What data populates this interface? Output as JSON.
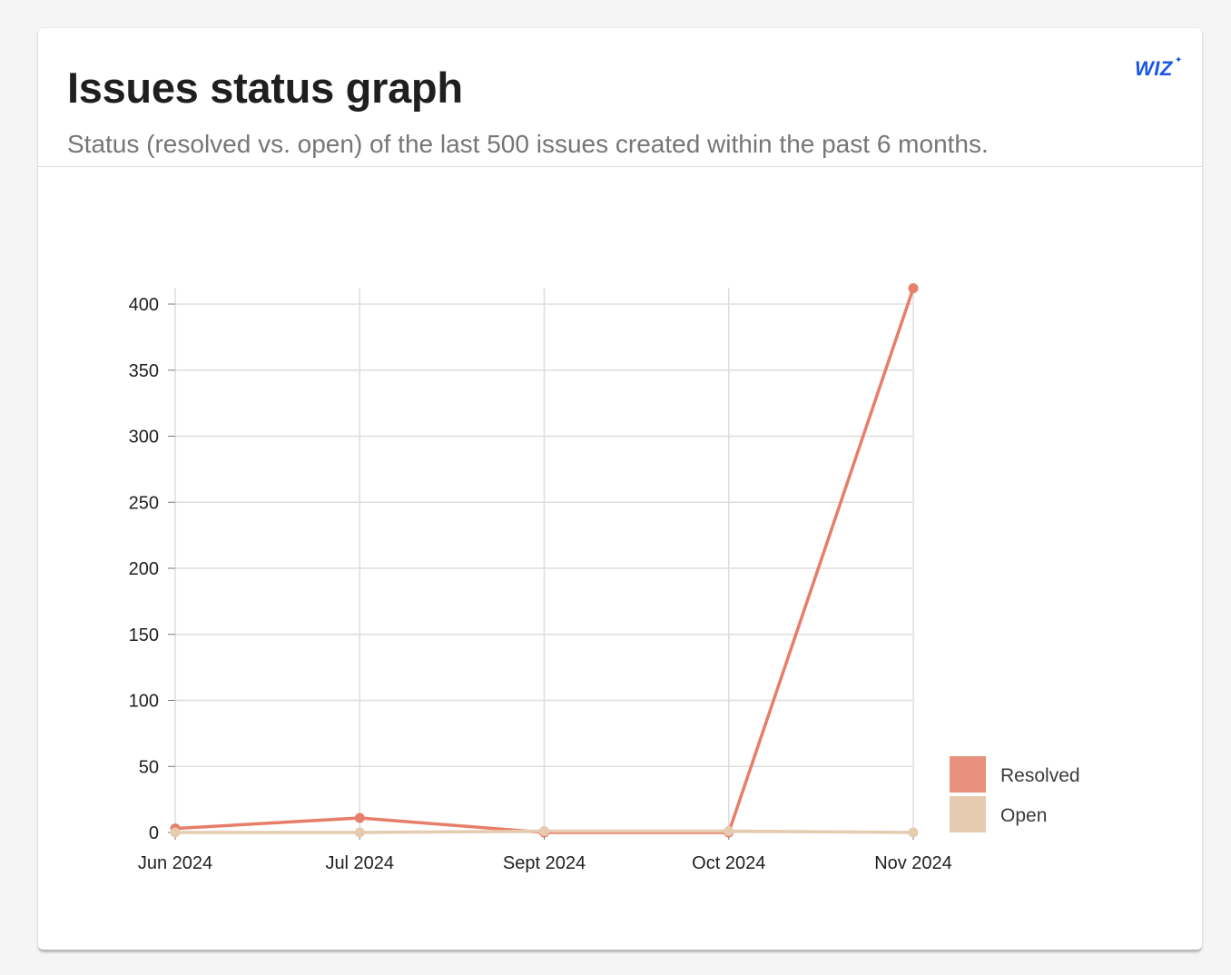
{
  "card": {
    "title": "Issues status graph",
    "subtitle": "Status (resolved vs. open) of the last 500 issues created within the past 6 months.",
    "logo_text": "WIZ",
    "logo_sparkle": "✦"
  },
  "colors": {
    "resolved": "#e8917d",
    "resolved_line": "#e67e6a",
    "open": "#e6cbb0",
    "grid": "#dddddd",
    "brand": "#1a55e8"
  },
  "chart_data": {
    "type": "line",
    "title": "",
    "xlabel": "",
    "ylabel": "",
    "categories": [
      "Jun 2024",
      "Jul 2024",
      "Sept 2024",
      "Oct 2024",
      "Nov 2024"
    ],
    "ylim": [
      0,
      400
    ],
    "yticks": [
      0,
      50,
      100,
      150,
      200,
      250,
      300,
      350,
      400
    ],
    "grid": true,
    "legend": "right-bottom",
    "series": [
      {
        "name": "Resolved",
        "values": [
          3,
          11,
          0,
          0,
          412
        ]
      },
      {
        "name": "Open",
        "values": [
          0,
          0,
          1,
          1,
          0
        ]
      }
    ]
  }
}
